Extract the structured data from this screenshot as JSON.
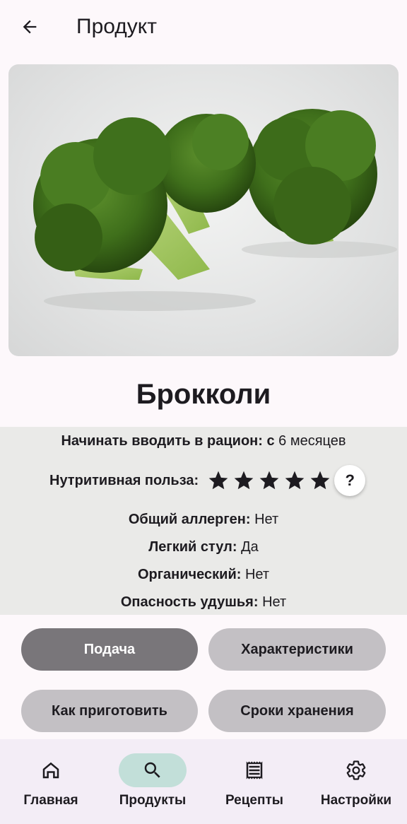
{
  "appbar": {
    "title": "Продукт",
    "back_icon": "arrow-back-icon"
  },
  "product": {
    "image_alt": "broccoli",
    "name": "Брокколи"
  },
  "info": {
    "intro_label": "Начинать вводить в рацион: с",
    "intro_value": "6 месяцев",
    "nutrition_label": "Нутритивная польза:",
    "nutrition_rating": 5,
    "nutrition_max": 5,
    "help_label": "?",
    "allergen_label": "Общий аллерген:",
    "allergen_value": "Нет",
    "stool_label": "Легкий стул:",
    "stool_value": "Да",
    "organic_label": "Органический:",
    "organic_value": "Нет",
    "choking_label": "Опасность удушья:",
    "choking_value": "Нет"
  },
  "actions": {
    "serving": "Подача",
    "characteristics": "Характеристики",
    "how_to_cook": "Как приготовить",
    "storage": "Сроки хранения"
  },
  "nav": {
    "items": [
      {
        "label": "Главная",
        "icon": "home-icon",
        "active": false
      },
      {
        "label": "Продукты",
        "icon": "search-icon",
        "active": true
      },
      {
        "label": "Рецепты",
        "icon": "receipt-icon",
        "active": false
      },
      {
        "label": "Настройки",
        "icon": "gear-icon",
        "active": false
      }
    ]
  },
  "colors": {
    "background": "#fdf8fb",
    "info_panel": "#eaeae8",
    "active_button": "#79767a",
    "inactive_button": "#c3c0c4",
    "nav_indicator": "#c2dfd9"
  }
}
